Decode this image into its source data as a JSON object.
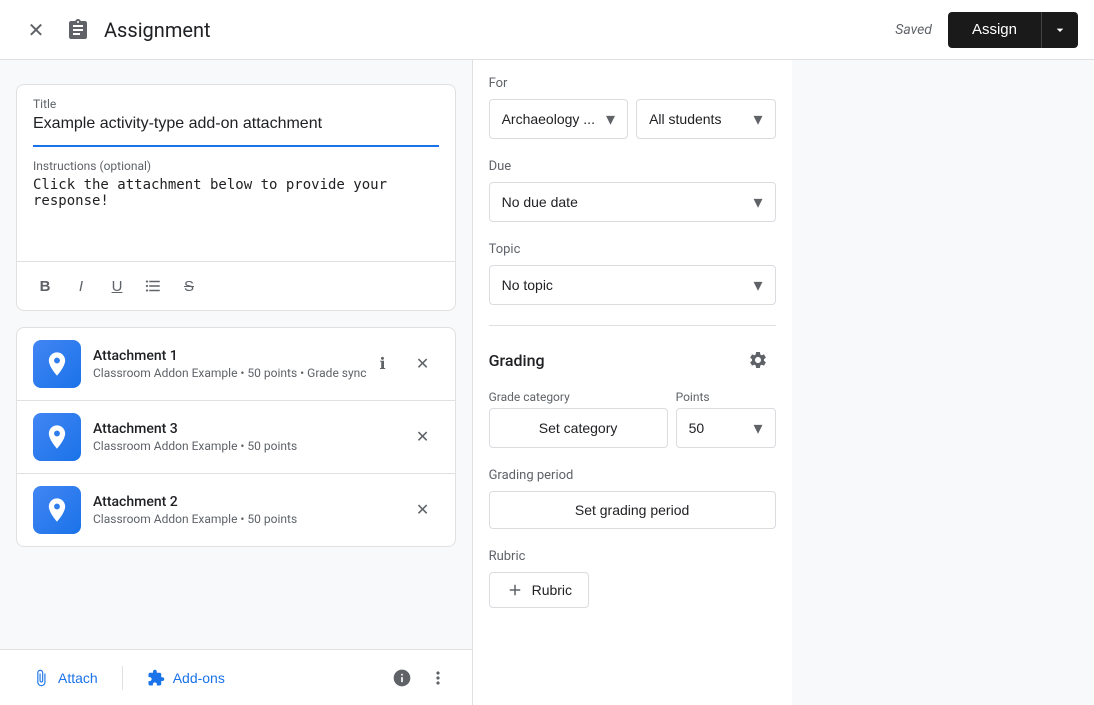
{
  "header": {
    "title": "Assignment",
    "saved_label": "Saved",
    "assign_label": "Assign"
  },
  "title_field": {
    "label": "Title",
    "value": "Example activity-type add-on attachment"
  },
  "instructions_field": {
    "label": "Instructions (optional)",
    "value": "Click the attachment below to provide your response!"
  },
  "toolbar": {
    "bold": "B",
    "italic": "I",
    "underline": "U",
    "list": "≡",
    "strikethrough": "S"
  },
  "attachments": [
    {
      "name": "Attachment 1",
      "meta": "Classroom Addon Example • 50 points • Grade sync"
    },
    {
      "name": "Attachment 3",
      "meta": "Classroom Addon Example • 50 points"
    },
    {
      "name": "Attachment 2",
      "meta": "Classroom Addon Example • 50 points"
    }
  ],
  "bottom_bar": {
    "attach_label": "Attach",
    "addons_label": "Add-ons"
  },
  "right_panel": {
    "for_label": "For",
    "class_value": "Archaeology ...",
    "students_value": "All students",
    "due_label": "Due",
    "due_value": "No due date",
    "topic_label": "Topic",
    "topic_value": "No topic",
    "grading_label": "Grading",
    "grade_category_label": "Grade category",
    "points_label": "Points",
    "set_category_label": "Set category",
    "points_value": "50",
    "grading_period_label": "Grading period",
    "set_grading_period_label": "Set grading period",
    "rubric_label": "Rubric",
    "add_rubric_label": "Rubric"
  }
}
